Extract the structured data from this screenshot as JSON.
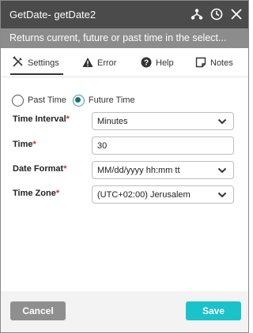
{
  "dialog": {
    "title": "GetDate-  getDate2",
    "description": "Returns current, future or past time in the select..."
  },
  "tabs": [
    {
      "label": "Settings",
      "icon": "tools-icon",
      "active": true
    },
    {
      "label": "Error",
      "icon": "warning-icon",
      "active": false
    },
    {
      "label": "Help",
      "icon": "help-icon",
      "active": false
    },
    {
      "label": "Notes",
      "icon": "note-icon",
      "active": false
    }
  ],
  "time_direction": {
    "options": [
      "Past Time",
      "Future Time"
    ],
    "selected": "Future Time"
  },
  "fields": {
    "time_interval": {
      "label": "Time Interval",
      "required": "*",
      "value": "Minutes"
    },
    "time": {
      "label": "Time",
      "required": "*",
      "value": "30"
    },
    "date_format": {
      "label": "Date Format",
      "required": "*",
      "value": "MM/dd/yyyy hh:mm tt"
    },
    "time_zone": {
      "label": "Time Zone",
      "required": "*",
      "value": "(UTC+02:00) Jerusalem"
    }
  },
  "buttons": {
    "cancel": "Cancel",
    "save": "Save"
  },
  "colors": {
    "titlebar": "#4b4b4b",
    "descbar": "#8c8c8c",
    "accent": "#19c3c9",
    "required": "#c0392b"
  }
}
